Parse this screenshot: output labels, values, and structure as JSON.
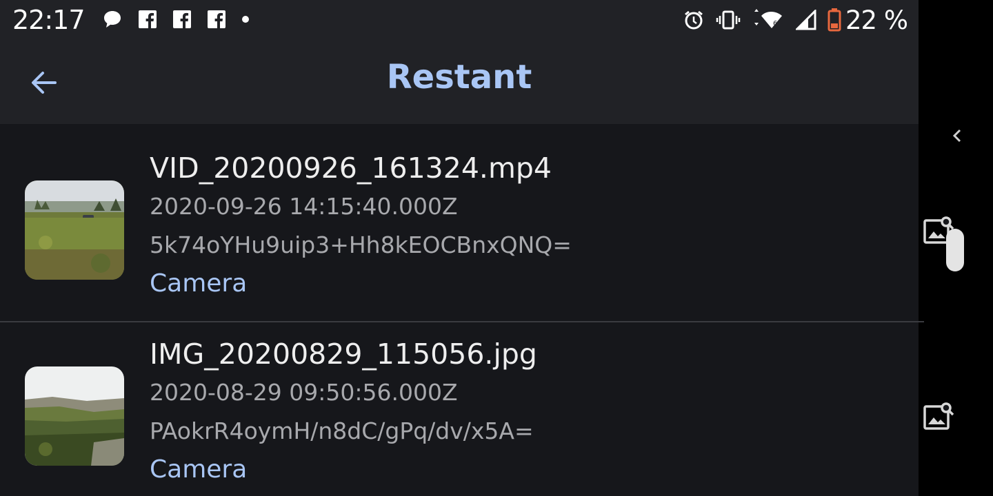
{
  "status_bar": {
    "time": "22:17",
    "battery_percent": "22 %",
    "left_icons": [
      "message-bubble-icon",
      "facebook-icon",
      "facebook-icon",
      "facebook-icon",
      "dot-icon"
    ],
    "right_icons": [
      "alarm-icon",
      "vibrate-icon",
      "wifi-icon",
      "signal-icon",
      "battery-low-icon"
    ],
    "battery_color": "#e8683e"
  },
  "app_bar": {
    "title": "Restant",
    "back_icon": "arrow-left-icon",
    "accent_color": "#a9c6f5"
  },
  "items": [
    {
      "name": "VID_20200926_161324.mp4",
      "date": "2020-09-26 14:15:40.000Z",
      "hash": "5k74oYHu9uip3+Hh8kEOCBnxQNQ=",
      "album": "Camera",
      "thumbnail": "field-with-trees-thumbnail",
      "action_icon": "image-search-icon"
    },
    {
      "name": "IMG_20200829_115056.jpg",
      "date": "2020-08-29 09:50:56.000Z",
      "hash": "PAokrR4oymH/n8dC/gPq/dv/x5A=",
      "album": "Camera",
      "thumbnail": "valley-landscape-thumbnail",
      "action_icon": "image-search-icon"
    }
  ]
}
